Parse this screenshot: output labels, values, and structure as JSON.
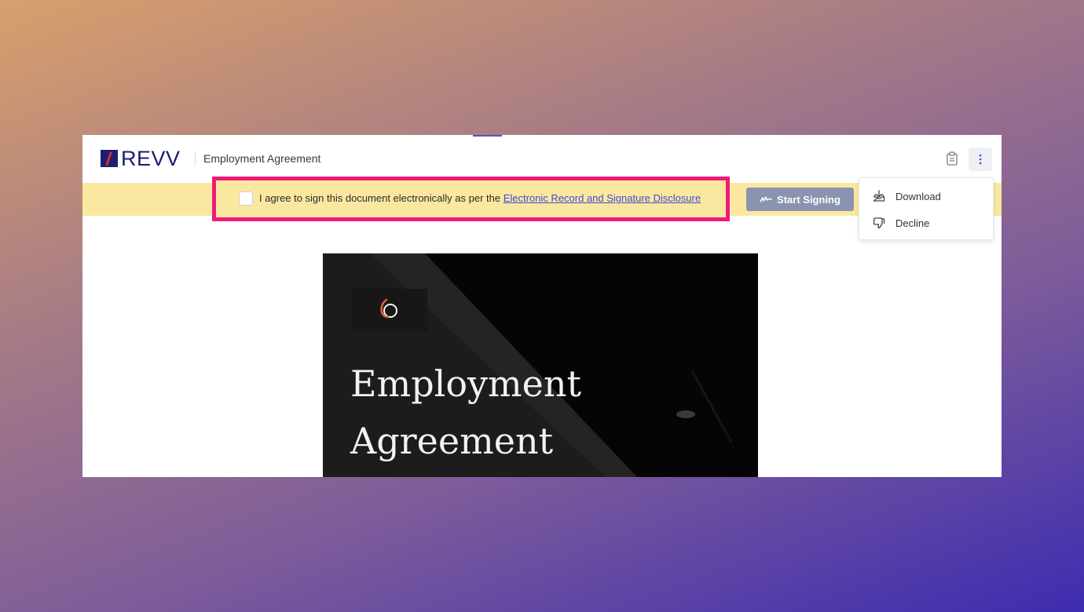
{
  "header": {
    "logo_text": "REVV",
    "document_title": "Employment Agreement",
    "icons": {
      "clipboard": "clipboard-icon",
      "more": "vertical-ellipsis-icon"
    }
  },
  "consent": {
    "text": "I agree to sign this document electronically as per the ",
    "link_text": "Electronic Record and Signature Disclosure",
    "checked": false
  },
  "actions": {
    "start_signing_label": "Start Signing",
    "start_signing_icon": "signature-icon"
  },
  "menu": {
    "items": [
      {
        "label": "Download",
        "icon": "download-tray-icon"
      },
      {
        "label": "Decline",
        "icon": "thumbs-down-icon"
      }
    ]
  },
  "preview": {
    "heading_line1": "Employment",
    "heading_line2": "Agreement"
  },
  "colors": {
    "brand": "#1c1f6e",
    "brand_accent": "#e0283c",
    "highlight_border": "#f01a78",
    "consent_bar": "#fbe8a0",
    "button": "#8a93b0",
    "link": "#3b4bd6"
  }
}
